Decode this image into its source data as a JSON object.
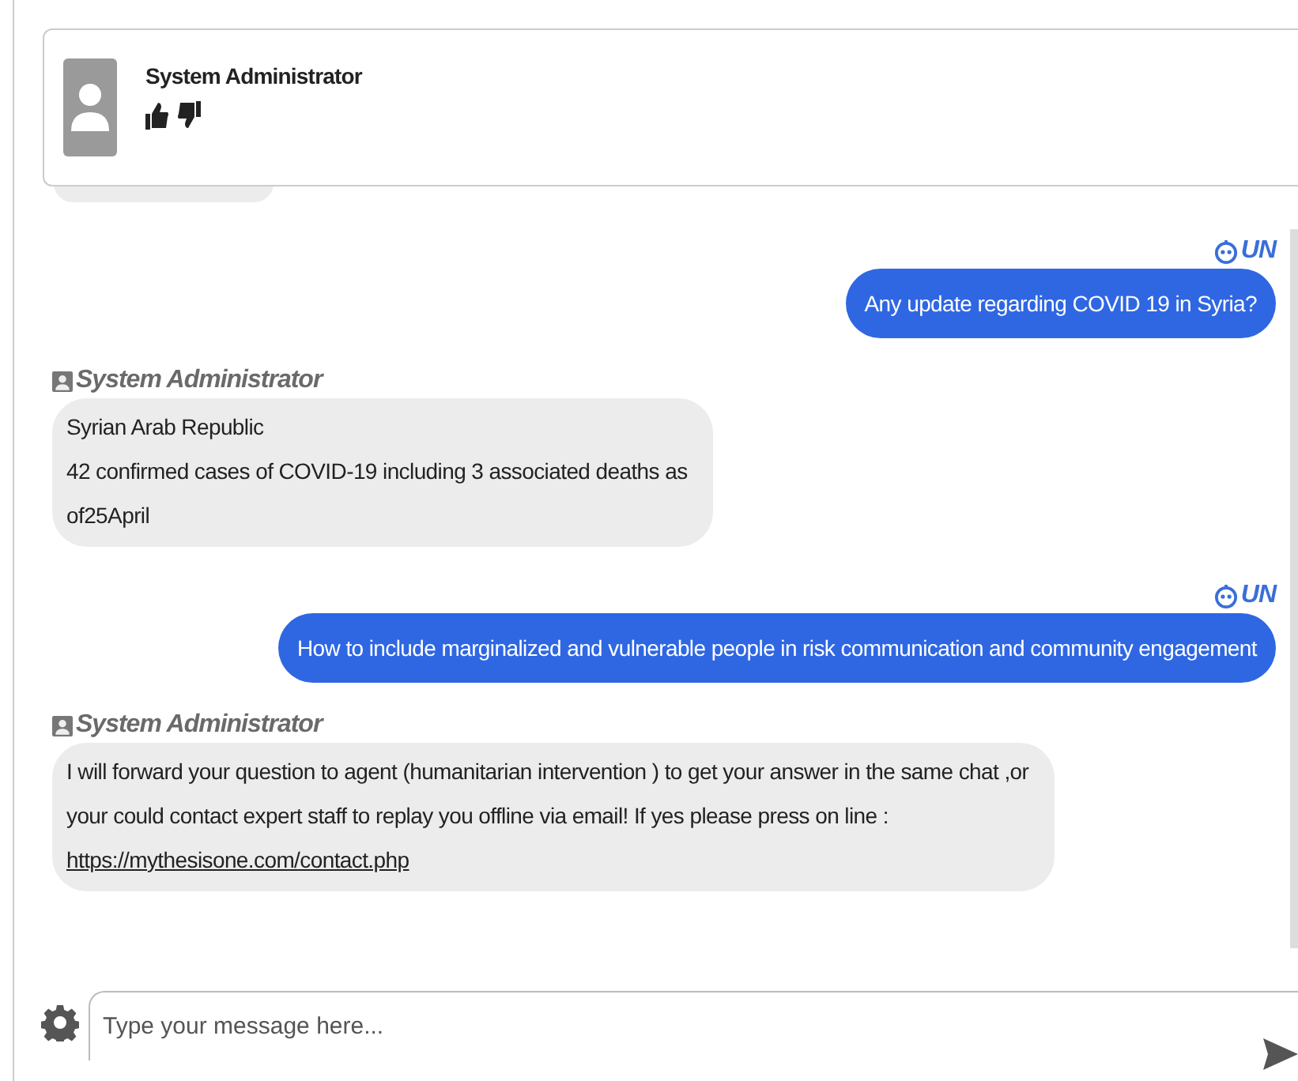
{
  "header": {
    "name": "System Administrator"
  },
  "messages": [
    {
      "kind": "partial"
    },
    {
      "kind": "user",
      "sender": "UN",
      "lines": [
        "Any update regarding COVID 19 in Syria?"
      ]
    },
    {
      "kind": "bot",
      "sender": "System Administrator",
      "lines": [
        "Syrian Arab Republic",
        "42 confirmed cases of COVID-19 including 3 associated deaths as",
        "of25April"
      ]
    },
    {
      "kind": "user",
      "sender": "UN",
      "lines": [
        "How to include marginalized and vulnerable people in risk communication and community engagement"
      ]
    },
    {
      "kind": "bot",
      "sender": "System Administrator",
      "lines": [
        "I will forward your question to agent (humanitarian intervention ) to get your answer in the same chat ,or",
        "your could contact expert staff to replay you offline via email! If yes please press on line :"
      ],
      "link": "https://mythesisone.com/contact.php"
    }
  ],
  "composer": {
    "placeholder": "Type your message here..."
  }
}
